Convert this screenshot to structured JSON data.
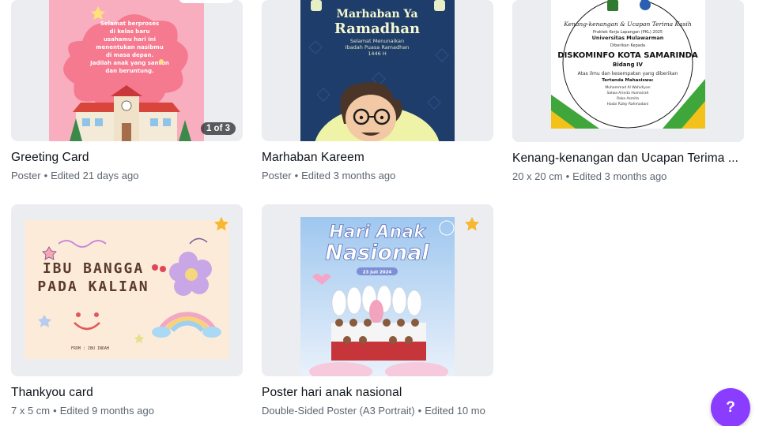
{
  "designs": [
    {
      "title": "Greeting Card",
      "type": "Poster",
      "edited": "Edited 21 days ago",
      "page_badge": "1 of 3",
      "thumb_text": "Selamat berproses di kelas baru usahamu hari ini menentukan nasibmu di masa depan. Jadilah anak yang santun dan beruntung."
    },
    {
      "title": "Marhaban Kareem",
      "type": "Poster",
      "edited": "Edited 3 months ago",
      "thumb_title_1": "Marhaban Ya",
      "thumb_title_2": "Ramadhan",
      "thumb_sub_1": "Selamat Menunaikan",
      "thumb_sub_2": "Ibadah Puasa Ramadhan",
      "thumb_sub_3": "1446 H"
    },
    {
      "title": "Kenang-kenangan dan Ucapan Terima ...",
      "type": "20 x 20 cm",
      "edited": "Edited 3 months ago",
      "thumb_heading": "Kenang-kenangan & Ucapan Terima Kasih",
      "thumb_line_1": "Praktek Kerja Lapangan (PKL) 2025",
      "thumb_line_2": "Universitas Mulawarman",
      "thumb_line_3": "Diberikan Kepada",
      "thumb_org": "DISKOMINFO KOTA SAMARINDA",
      "thumb_div": "Bidang IV",
      "thumb_line_4": "Atas ilmu dan kesempatan yang diberikan",
      "thumb_line_5": "Tertanda Mahasiswa:",
      "thumb_names": [
        "Muhammad Al Wahidiyan",
        "Salwa Arinda Humairah",
        "Raka Asmita",
        "Hasbi Rizky Rahmadani"
      ]
    },
    {
      "title": "Thankyou card",
      "type": "7 x 5 cm",
      "edited": "Edited 9 months ago",
      "thumb_line_1": "IBU BANGGA",
      "thumb_line_2": "PADA KALIAN",
      "thumb_from": "FROM : IBU INDAH",
      "starred": true
    },
    {
      "title": "Poster hari anak nasional",
      "type": "Double-Sided Poster (A3 Portrait)",
      "edited": "Edited 10 mo",
      "thumb_title_1": "Hari Anak",
      "thumb_title_2": "Nasional",
      "thumb_date": "23 Juli 2024",
      "starred": true
    }
  ],
  "help": {
    "label": "?"
  },
  "colors": {
    "accent": "#8b3dff",
    "star": "#f7b731"
  }
}
